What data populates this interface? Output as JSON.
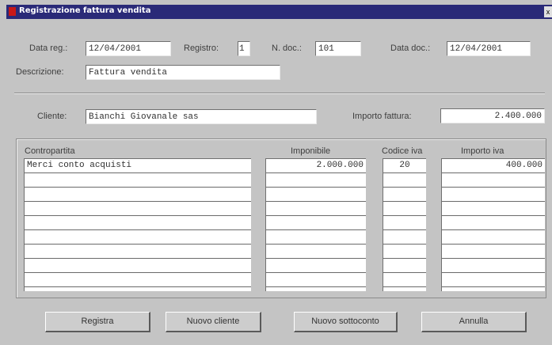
{
  "window": {
    "title": "Registrazione fattura vendita",
    "close_glyph": "x"
  },
  "form": {
    "data_reg_label": "Data reg.:",
    "data_reg_value": "12/04/2001",
    "registro_label": "Registro:",
    "registro_value": "1",
    "ndoc_label": "N. doc.:",
    "ndoc_value": "101",
    "data_doc_label": "Data doc.:",
    "data_doc_value": "12/04/2001",
    "descrizione_label": "Descrizione:",
    "descrizione_value": "Fattura vendita",
    "cliente_label": "Cliente:",
    "cliente_value": "Bianchi Giovanale sas",
    "importo_fattura_label": "Importo fattura:",
    "importo_fattura_value": "2.400.000"
  },
  "grid": {
    "headers": {
      "contropartita": "Contropartita",
      "imponibile": "Imponibile",
      "codice_iva": "Codice iva",
      "importo_iva": "Importo iva"
    },
    "rows": [
      {
        "contropartita": "Merci conto acquisti",
        "imponibile": "2.000.000",
        "codice_iva": "20",
        "importo_iva": "400.000"
      }
    ]
  },
  "buttons": {
    "registra": "Registra",
    "nuovo_cliente": "Nuovo cliente",
    "nuovo_sottoconto": "Nuovo sottoconto",
    "annulla": "Annulla"
  },
  "colors": {
    "titlebar": "#2a2a78",
    "window": "#c4c4c4"
  }
}
